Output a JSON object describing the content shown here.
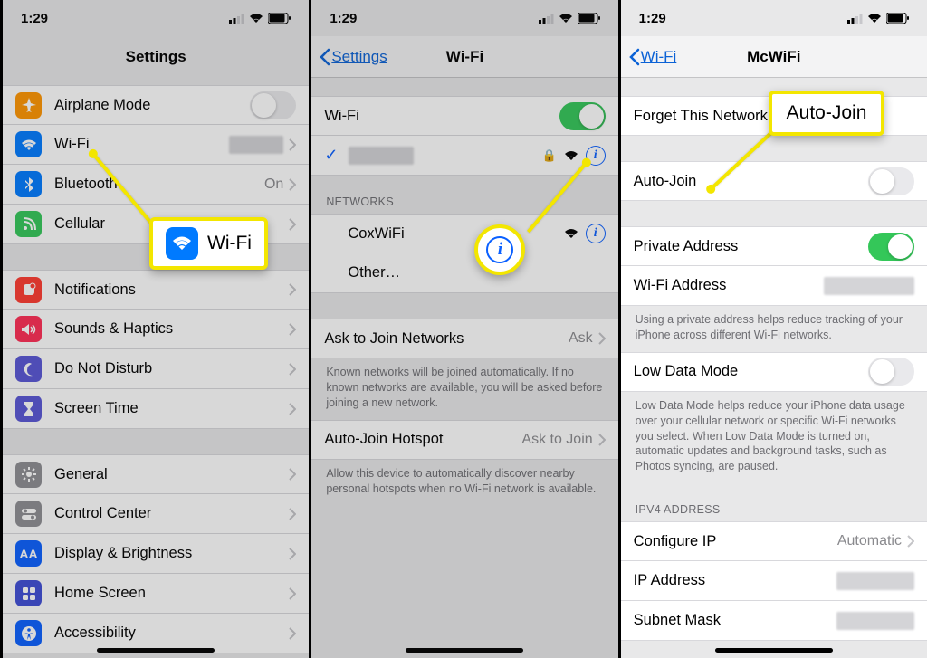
{
  "status": {
    "time": "1:29"
  },
  "screen1": {
    "title": "Settings",
    "rows1": [
      {
        "label": "Airplane Mode",
        "value": "",
        "iconColor": "#ff9500",
        "icon": "airplane"
      },
      {
        "label": "Wi-Fi",
        "value": "",
        "iconColor": "#007aff",
        "icon": "wifi",
        "blurValue": true
      },
      {
        "label": "Bluetooth",
        "value": "On",
        "iconColor": "#007aff",
        "icon": "bt"
      },
      {
        "label": "Cellular",
        "value": "",
        "iconColor": "#34c759",
        "icon": "cell"
      }
    ],
    "rows2": [
      {
        "label": "Notifications",
        "iconColor": "#ff3b30",
        "icon": "notif"
      },
      {
        "label": "Sounds & Haptics",
        "iconColor": "#ff2d55",
        "icon": "sound"
      },
      {
        "label": "Do Not Disturb",
        "iconColor": "#5856d6",
        "icon": "moon"
      },
      {
        "label": "Screen Time",
        "iconColor": "#5856d6",
        "icon": "time"
      }
    ],
    "rows3": [
      {
        "label": "General",
        "iconColor": "#8e8e93",
        "icon": "gear"
      },
      {
        "label": "Control Center",
        "iconColor": "#8e8e93",
        "icon": "cc"
      },
      {
        "label": "Display & Brightness",
        "iconColor": "#0a60ff",
        "icon": "aa"
      },
      {
        "label": "Home Screen",
        "iconColor": "#3f4dd6",
        "icon": "home"
      },
      {
        "label": "Accessibility",
        "iconColor": "#0a60ff",
        "icon": "acc"
      }
    ],
    "callout": "Wi-Fi"
  },
  "screen2": {
    "back": "Settings",
    "title": "Wi-Fi",
    "wifiLabel": "Wi-Fi",
    "networksHdr": "NETWORKS",
    "networks": [
      {
        "label": "CoxWiFi"
      },
      {
        "label": "Other…"
      }
    ],
    "ask": {
      "label": "Ask to Join Networks",
      "value": "Ask"
    },
    "askFoot": "Known networks will be joined automatically. If no known networks are available, you will be asked before joining a new network.",
    "auto": {
      "label": "Auto-Join Hotspot",
      "value": "Ask to Join"
    },
    "autoFoot": "Allow this device to automatically discover nearby personal hotspots when no Wi-Fi network is available."
  },
  "screen3": {
    "back": "Wi-Fi",
    "title": "McWiFi",
    "forget": "Forget This Network",
    "autojoin": "Auto-Join",
    "private": "Private Address",
    "wifiaddr": "Wi-Fi Address",
    "privFoot": "Using a private address helps reduce tracking of your iPhone across different Wi-Fi networks.",
    "lowdata": "Low Data Mode",
    "lowdataFoot": "Low Data Mode helps reduce your iPhone data usage over your cellular network or specific Wi-Fi networks you select. When Low Data Mode is turned on, automatic updates and background tasks, such as Photos syncing, are paused.",
    "ipv4Hdr": "IPV4 ADDRESS",
    "configIP": {
      "label": "Configure IP",
      "value": "Automatic"
    },
    "ipaddr": "IP Address",
    "subnet": "Subnet Mask",
    "callout": "Auto-Join"
  }
}
